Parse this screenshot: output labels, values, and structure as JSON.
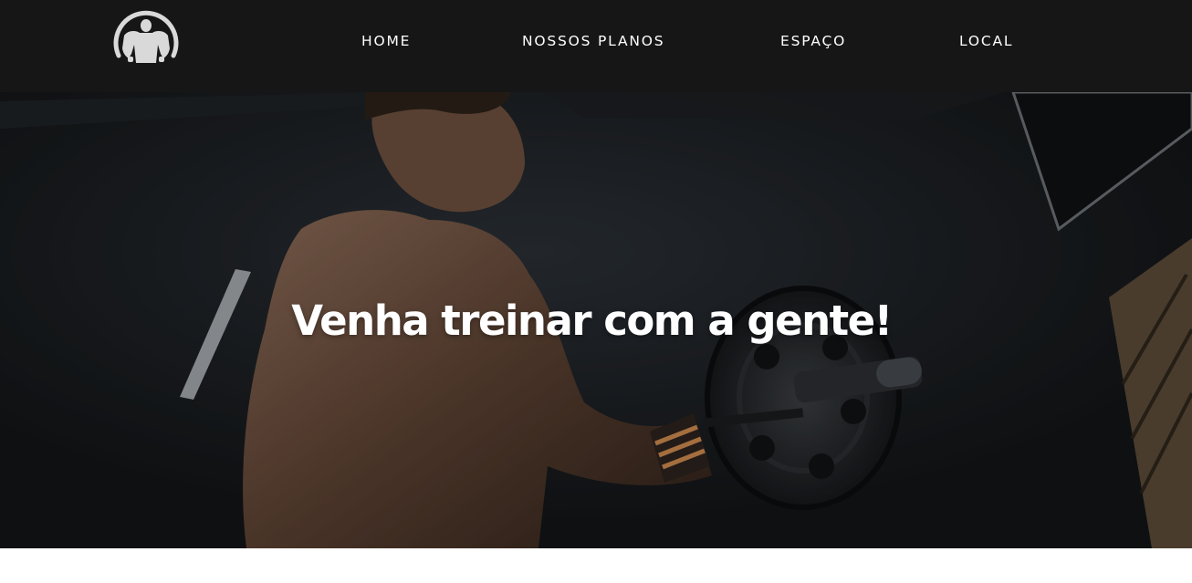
{
  "header": {
    "logo_icon": "bodybuilder-logo-icon",
    "nav": {
      "home": "HOME",
      "planos": "NOSSOS PLANOS",
      "espaco": "ESPAÇO",
      "local": "LOCAL"
    }
  },
  "hero": {
    "title": "Venha treinar com a gente!",
    "background_image": "athlete-lifting-barbell"
  },
  "colors": {
    "header_bg": "#161616",
    "hero_overlay": "#17191b",
    "text": "#ffffff"
  }
}
